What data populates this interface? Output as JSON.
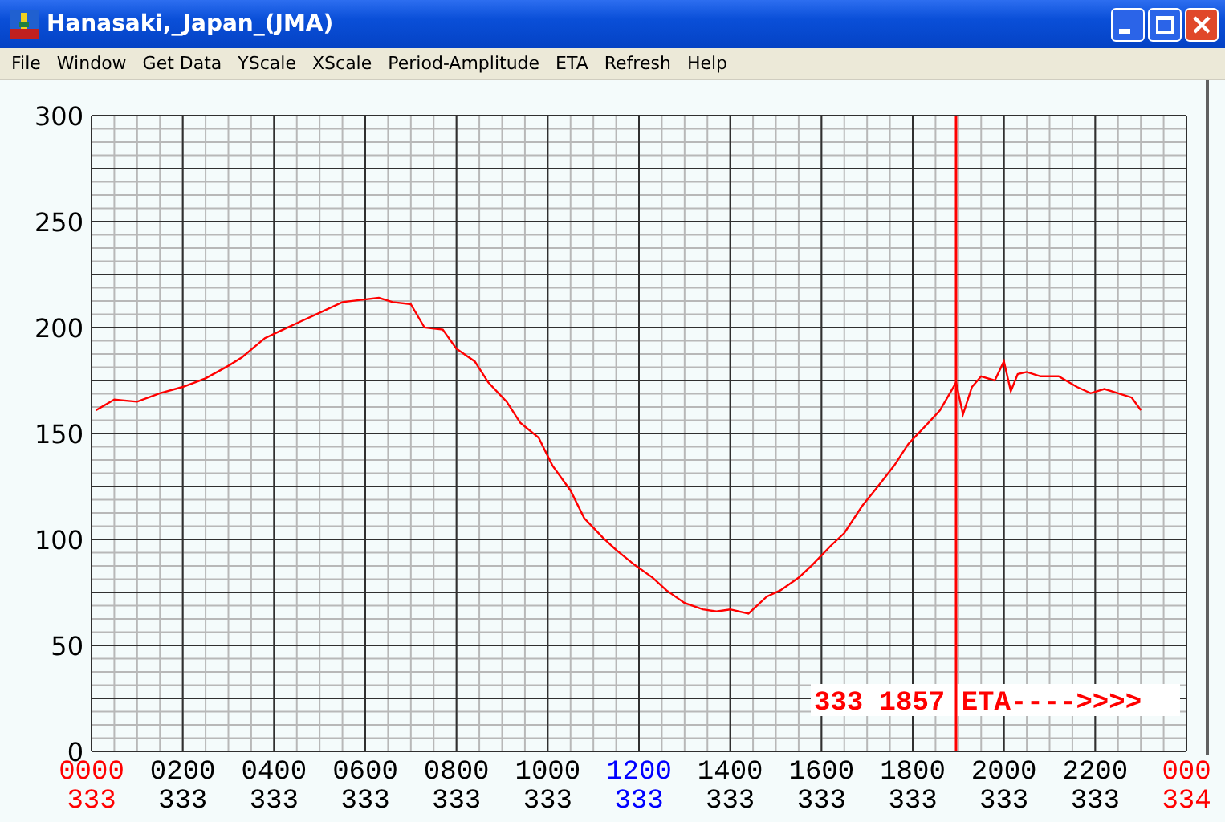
{
  "window": {
    "title": "Hanasaki,_Japan_(JMA)"
  },
  "menu": [
    "File",
    "Window",
    "Get Data",
    "YScale",
    "XScale",
    "Period-Amplitude",
    "ETA",
    "Refresh",
    "Help"
  ],
  "chart": {
    "chart_data": {
      "type": "line",
      "x": [
        10,
        50,
        100,
        150,
        200,
        250,
        300,
        330,
        380,
        420,
        460,
        500,
        550,
        590,
        630,
        660,
        700,
        730,
        770,
        800,
        840,
        870,
        910,
        940,
        980,
        1010,
        1050,
        1080,
        1120,
        1150,
        1190,
        1230,
        1260,
        1300,
        1340,
        1370,
        1400,
        1440,
        1480,
        1510,
        1550,
        1580,
        1620,
        1650,
        1690,
        1720,
        1760,
        1790,
        1830,
        1860,
        1895,
        1910,
        1930,
        1950,
        1980,
        2000,
        2015,
        2030,
        2050,
        2080,
        2120,
        2160,
        2190,
        2220,
        2250,
        2280,
        2300
      ],
      "series": [
        {
          "color": "#ff0000",
          "values": [
            161,
            166,
            165,
            169,
            172,
            176,
            182,
            186,
            195,
            199,
            203,
            207,
            212,
            213,
            214,
            212,
            211,
            200,
            199,
            190,
            184,
            174,
            165,
            155,
            148,
            135,
            123,
            110,
            101,
            95,
            88,
            82,
            76,
            70,
            67,
            66,
            67,
            65,
            73,
            76,
            82,
            88,
            97,
            103,
            116,
            124,
            135,
            145,
            154,
            161,
            174,
            159,
            172,
            177,
            175,
            184,
            170,
            178,
            179,
            177,
            177,
            172,
            169,
            171,
            169,
            167,
            161
          ]
        }
      ],
      "xlim": [
        0,
        2400
      ],
      "ylim": [
        0,
        300
      ],
      "xticks": [
        {
          "value": 0,
          "label": "0000"
        },
        {
          "value": 200,
          "label": "0200"
        },
        {
          "value": 400,
          "label": "0400"
        },
        {
          "value": 600,
          "label": "0600"
        },
        {
          "value": 800,
          "label": "0800"
        },
        {
          "value": 1000,
          "label": "1000"
        },
        {
          "value": 1200,
          "label": "1200"
        },
        {
          "value": 1400,
          "label": "1400"
        },
        {
          "value": 1600,
          "label": "1600"
        },
        {
          "value": 1800,
          "label": "1800"
        },
        {
          "value": 2000,
          "label": "2000"
        },
        {
          "value": 2200,
          "label": "2200"
        }
      ],
      "yticks": [
        {
          "value": 0,
          "label": "0"
        },
        {
          "value": 50,
          "label": "50"
        },
        {
          "value": 100,
          "label": "100"
        },
        {
          "value": 150,
          "label": "150"
        },
        {
          "value": 200,
          "label": "200"
        },
        {
          "value": 250,
          "label": "250"
        },
        {
          "value": 300,
          "label": "300"
        }
      ],
      "ref_lines": [
        {
          "axis": "x",
          "value": 1895
        }
      ],
      "grid": true,
      "annotations": [
        "333 1857 ETA---->>>>"
      ]
    },
    "x_axis_labels": [
      {
        "day": "333",
        "color": "#ff0000"
      },
      {
        "day": "333",
        "color": "#000000"
      },
      {
        "day": "333",
        "color": "#000000"
      },
      {
        "day": "333",
        "color": "#000000"
      },
      {
        "day": "333",
        "color": "#000000"
      },
      {
        "day": "333",
        "color": "#000000"
      },
      {
        "day": "333",
        "color": "#0000ff"
      },
      {
        "day": "333",
        "color": "#000000"
      },
      {
        "day": "333",
        "color": "#000000"
      },
      {
        "day": "333",
        "color": "#000000"
      },
      {
        "day": "333",
        "color": "#000000"
      },
      {
        "day": "333",
        "color": "#000000"
      },
      {
        "time": "000",
        "day": "334",
        "color": "#ff0000"
      }
    ]
  }
}
